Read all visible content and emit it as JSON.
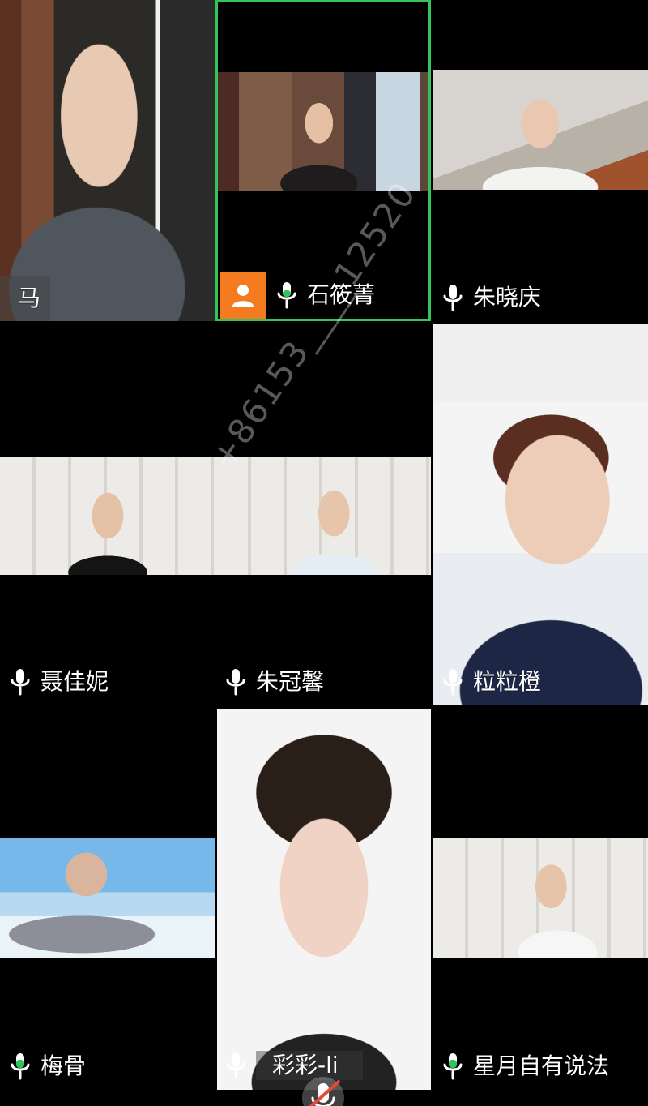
{
  "participants": [
    {
      "name": "马",
      "mic": "none"
    },
    {
      "name": "石筱菁",
      "mic": "on",
      "active": true
    },
    {
      "name": "朱晓庆",
      "mic": "on"
    },
    {
      "name": "聂佳妮",
      "mic": "on"
    },
    {
      "name": "朱冠馨",
      "mic": "on"
    },
    {
      "name": "粒粒橙",
      "mic": "on"
    },
    {
      "name": "梅骨",
      "mic": "speaking"
    },
    {
      "name": "彩彩-li",
      "mic": "on"
    },
    {
      "name": "星月自有说法",
      "mic": "speaking"
    }
  ],
  "watermark": "+86153____12520",
  "colors": {
    "active_border": "#33c45a",
    "avatar_badge": "#f47b20",
    "speaking_mic": "#2fc55a"
  }
}
